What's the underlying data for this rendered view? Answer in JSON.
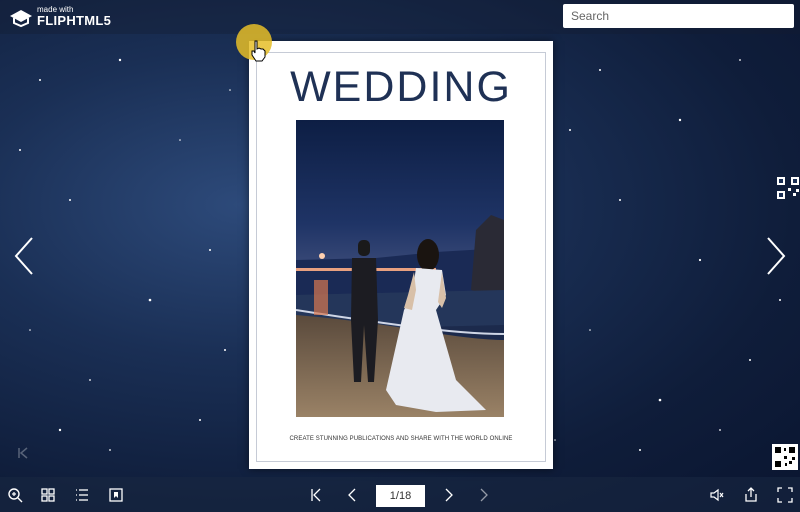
{
  "brand": {
    "line1": "made with",
    "line2": "FLIPHTML5"
  },
  "search": {
    "placeholder": "Search"
  },
  "book": {
    "title": "WEDDING",
    "footer": "CREATE STUNNING PUBLICATIONS AND SHARE WITH THE WORLD ONLINE"
  },
  "toolbar": {
    "page_indicator": "1/18",
    "left_icons": [
      "zoom-in-icon",
      "thumbnails-icon",
      "table-of-contents-icon",
      "bookmark-icon"
    ],
    "center_icons": [
      "first-page-icon",
      "previous-page-icon",
      "next-page-icon",
      "last-page-icon"
    ],
    "right_icons": [
      "sound-icon",
      "share-icon",
      "fullscreen-icon"
    ]
  },
  "colors": {
    "accent": "#e6be28",
    "title": "#1f3155",
    "background": "#1a2f55"
  }
}
